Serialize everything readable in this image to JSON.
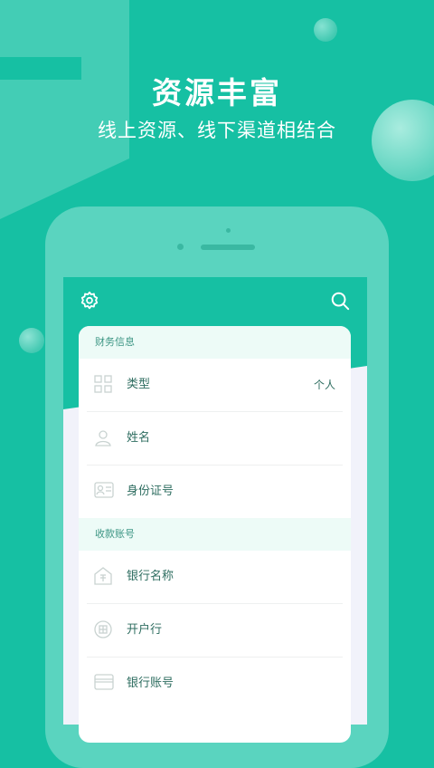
{
  "headline": "资源丰富",
  "subline": "线上资源、线下渠道相结合",
  "colors": {
    "background": "#16c0a3",
    "phone": "#5ad4bf",
    "section_bg": "#edfbf7",
    "label": "#2f6e61"
  },
  "toolbar": {
    "left_icon": "gear-icon",
    "right_icon": "search-icon"
  },
  "sections": [
    {
      "title": "财务信息",
      "rows": [
        {
          "icon": "grid-icon",
          "label": "类型",
          "value": "个人"
        },
        {
          "icon": "user-icon",
          "label": "姓名",
          "value": ""
        },
        {
          "icon": "id-card-icon",
          "label": "身份证号",
          "value": ""
        }
      ]
    },
    {
      "title": "收款账号",
      "rows": [
        {
          "icon": "bank-icon",
          "label": "银行名称",
          "value": ""
        },
        {
          "icon": "branch-icon",
          "label": "开户行",
          "value": ""
        },
        {
          "icon": "card-icon",
          "label": "银行账号",
          "value": ""
        }
      ]
    }
  ]
}
